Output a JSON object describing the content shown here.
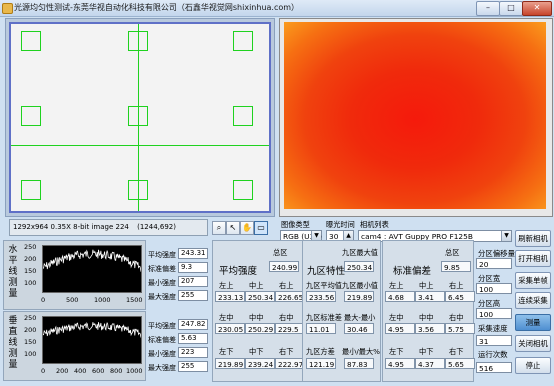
{
  "window": {
    "title": "光源均匀性测试-东莞华视自动化科技有限公司（石鑫华视觉网shixinhua.com）",
    "min_label": "–",
    "max_label": "□",
    "close_label": "✕"
  },
  "image_info": {
    "text": "1292x964 0.35X 8-bit image 224",
    "coords": "(1244,692)"
  },
  "tools": [
    "zoom-icon",
    "pointer-icon",
    "pan-icon",
    "roi-icon"
  ],
  "camera": {
    "image_type_label": "图像类型",
    "image_type_value": "RGB (U32)",
    "exposure_label": "曝光时间",
    "exposure_value": "30",
    "camera_list_label": "相机列表",
    "camera_value": "cam4 : AVT Guppy PRO F125B"
  },
  "horizontal": {
    "label": "水平线测量",
    "yticks": [
      "250",
      "200",
      "150",
      "100"
    ],
    "xticks": [
      "0",
      "500",
      "1000",
      "1500"
    ],
    "stats": [
      {
        "label": "平均强度",
        "value": "243.31"
      },
      {
        "label": "标准偏差",
        "value": "9.3"
      },
      {
        "label": "最小强度",
        "value": "207"
      },
      {
        "label": "最大强度",
        "value": "255"
      }
    ]
  },
  "vertical": {
    "label": "垂直线测量",
    "yticks": [
      "250",
      "200",
      "150",
      "100"
    ],
    "xticks": [
      "0",
      "200",
      "400",
      "600",
      "800",
      "1000"
    ],
    "stats": [
      {
        "label": "平均强度",
        "value": "247.82"
      },
      {
        "label": "标准偏差",
        "value": "5.63"
      },
      {
        "label": "最小强度",
        "value": "223"
      },
      {
        "label": "最大强度",
        "value": "255"
      }
    ]
  },
  "avg_panel": {
    "title": "平均强度",
    "total_label": "总区",
    "total_value": "240.99",
    "top": [
      {
        "label": "左上",
        "value": "233.13"
      },
      {
        "label": "中上",
        "value": "250.34"
      },
      {
        "label": "右上",
        "value": "226.65"
      }
    ],
    "mid": [
      {
        "label": "左中",
        "value": "230.05"
      },
      {
        "label": "中中",
        "value": "250.29"
      },
      {
        "label": "右中",
        "value": "229.5"
      }
    ],
    "bot": [
      {
        "label": "左下",
        "value": "219.89"
      },
      {
        "label": "中下",
        "value": "239.24"
      },
      {
        "label": "右下",
        "value": "222.97"
      }
    ]
  },
  "nine_panel": {
    "title": "九区特性",
    "max_label": "九区最大值",
    "max_value": "250.34",
    "min_label": "九区最小值",
    "min_value": "219.89",
    "avg_label": "九区平均值",
    "avg_value": "233.56",
    "std_label": "九区标准差",
    "std_value": "11.01",
    "range_label": "最大-最小",
    "range_value": "30.46",
    "var_label": "九区方差",
    "var_value": "121.19",
    "ratio_label": "最小/最大%",
    "ratio_value": "87.83"
  },
  "std_panel": {
    "title": "标准偏差",
    "total_label": "总区",
    "total_value": "9.85",
    "top": [
      {
        "label": "左上",
        "value": "4.68"
      },
      {
        "label": "中上",
        "value": "3.41"
      },
      {
        "label": "右上",
        "value": "6.45"
      }
    ],
    "mid": [
      {
        "label": "左中",
        "value": "4.95"
      },
      {
        "label": "中中",
        "value": "3.56"
      },
      {
        "label": "右中",
        "value": "5.75"
      }
    ],
    "bot": [
      {
        "label": "左下",
        "value": "4.95"
      },
      {
        "label": "中下",
        "value": "4.37"
      },
      {
        "label": "右下",
        "value": "5.65"
      }
    ]
  },
  "side": {
    "scale_label": "分区偏移量",
    "scale_value": "20",
    "width_label": "分区宽",
    "width_value": "100",
    "height_label": "分区高",
    "height_value": "100",
    "speed_label": "采集速度",
    "speed_value": "31",
    "count_label": "运行次数",
    "count_value": "516"
  },
  "buttons": {
    "refresh": "刷新相机",
    "open": "打开相机",
    "single": "采集单帧",
    "continuous": "连续采集",
    "measure": "测量",
    "close": "关闭相机",
    "stop": "停止"
  },
  "colors": {
    "measure_active": "#4f8fd1",
    "box_green": "#1fd21f",
    "plot_bg": "#000000",
    "plot_line": "#ffffff"
  }
}
